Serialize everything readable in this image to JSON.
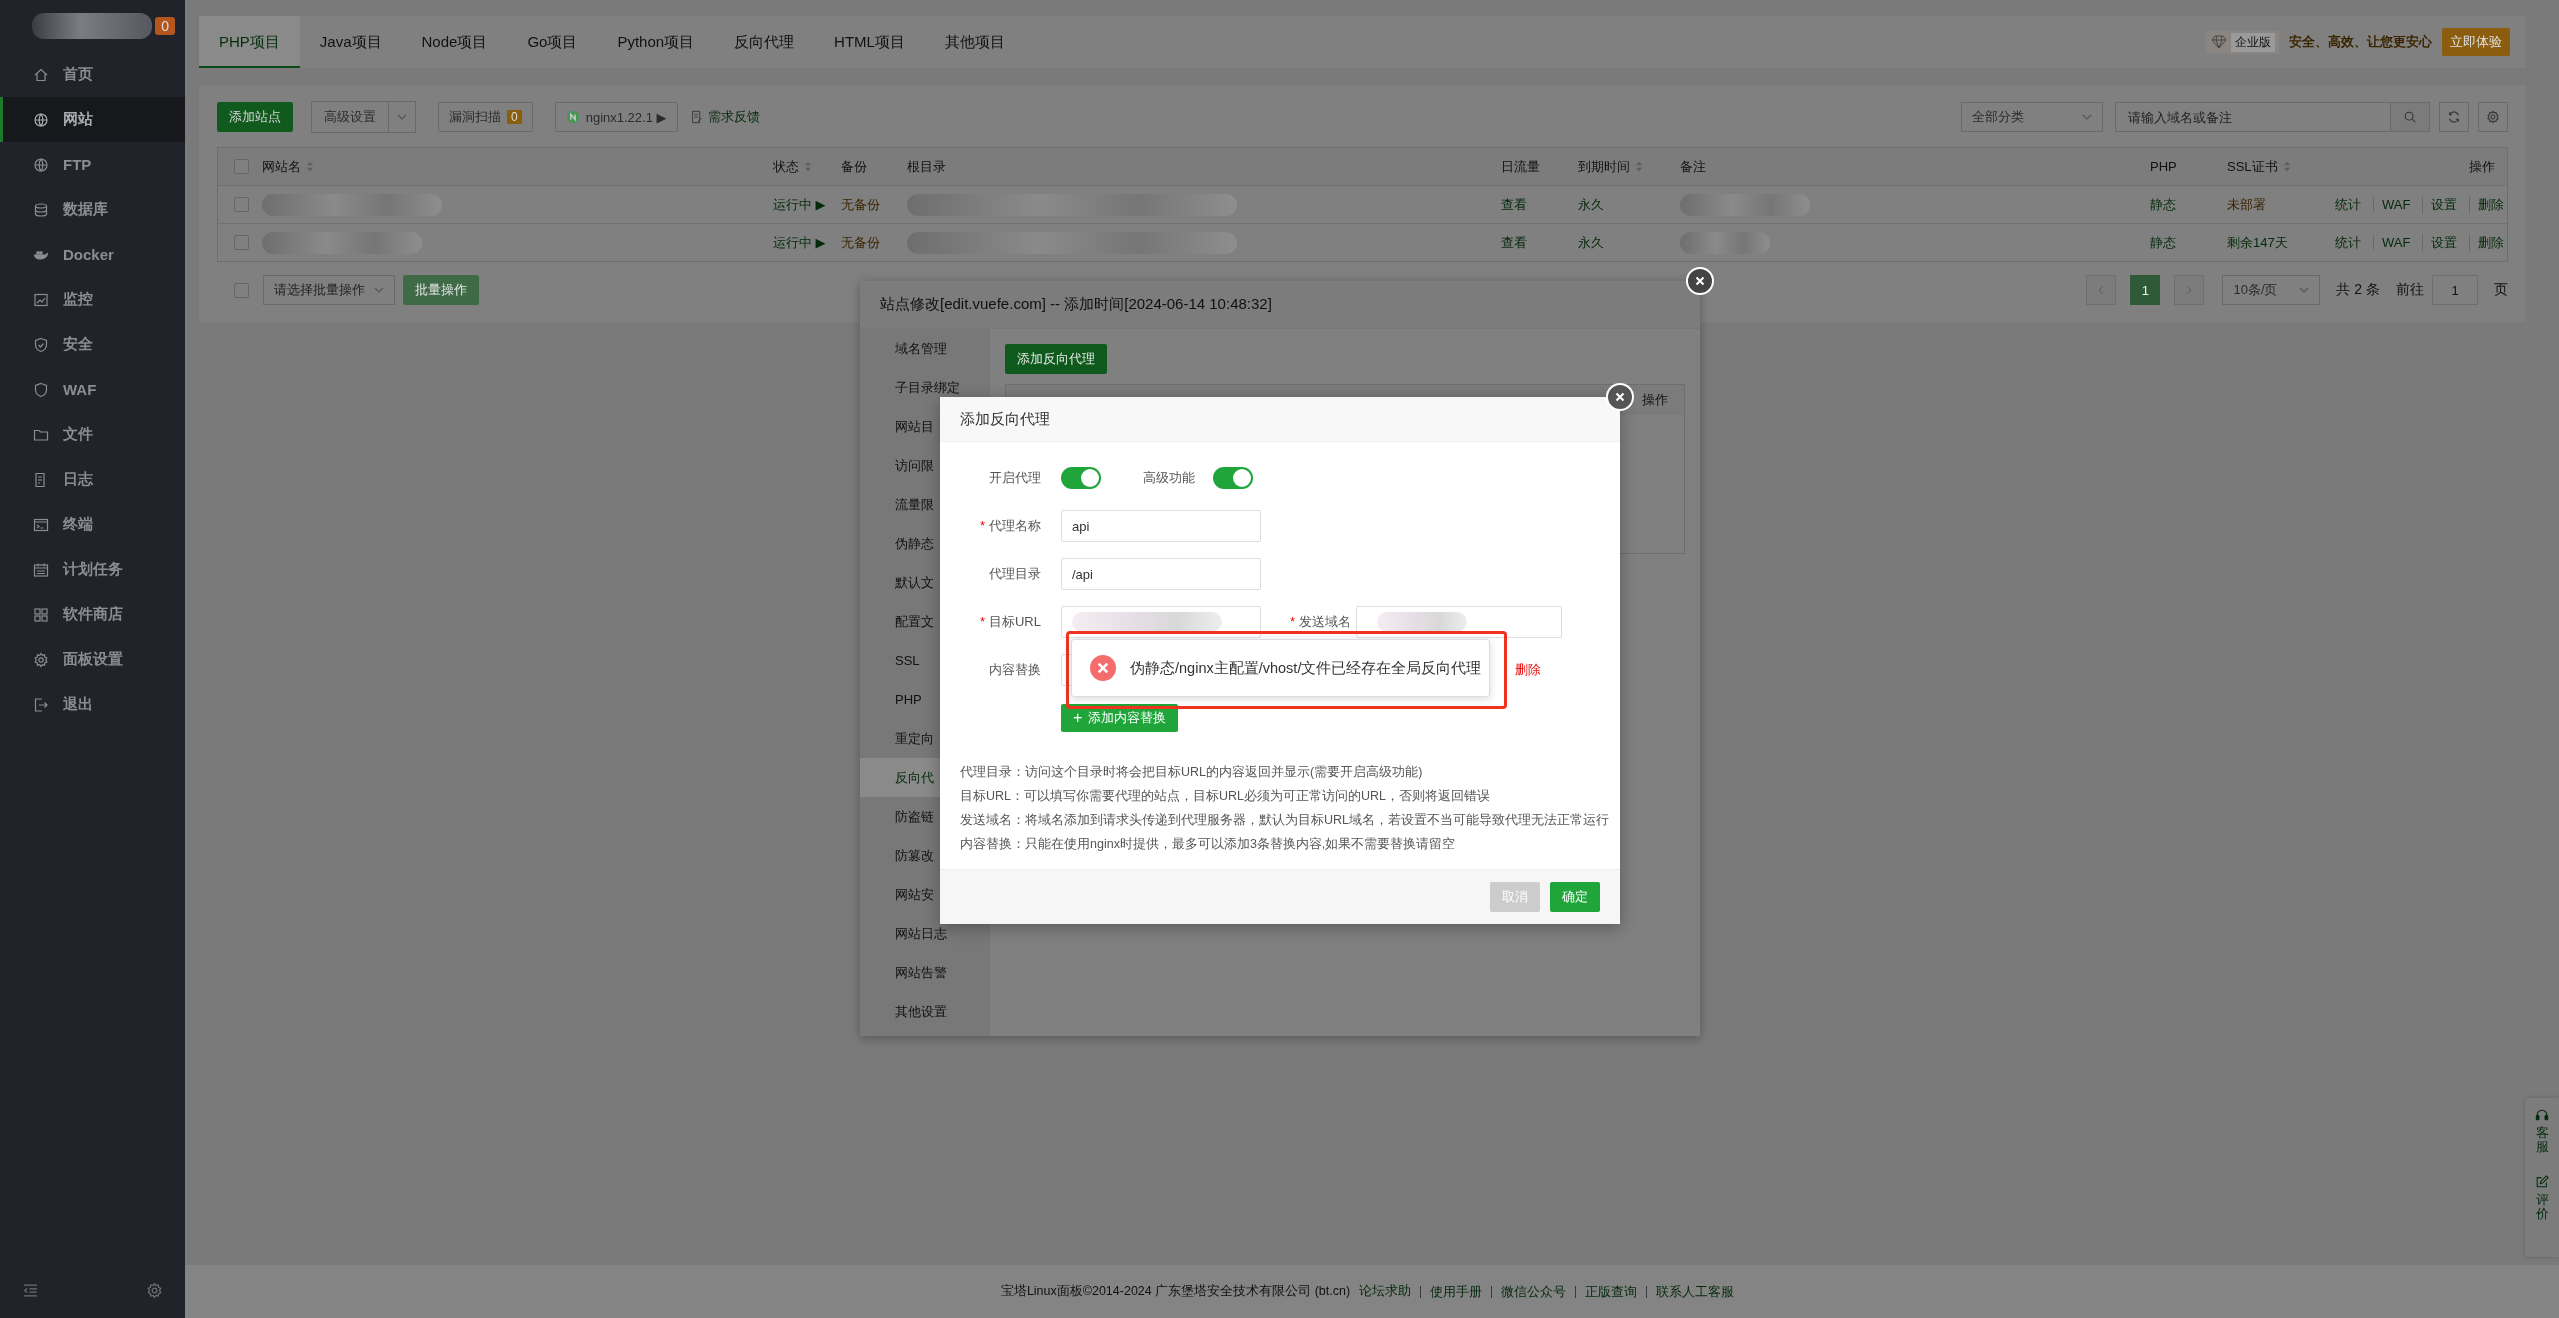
{
  "sidebar": {
    "badge": "0",
    "items": [
      {
        "label": "首页",
        "selected": false
      },
      {
        "label": "网站",
        "selected": true
      },
      {
        "label": "FTP",
        "selected": false
      },
      {
        "label": "数据库",
        "selected": false
      },
      {
        "label": "Docker",
        "selected": false
      },
      {
        "label": "监控",
        "selected": false
      },
      {
        "label": "安全",
        "selected": false
      },
      {
        "label": "WAF",
        "selected": false
      },
      {
        "label": "文件",
        "selected": false
      },
      {
        "label": "日志",
        "selected": false
      },
      {
        "label": "终端",
        "selected": false
      },
      {
        "label": "计划任务",
        "selected": false
      },
      {
        "label": "软件商店",
        "selected": false
      },
      {
        "label": "面板设置",
        "selected": false
      },
      {
        "label": "退出",
        "selected": false
      }
    ]
  },
  "tabs": [
    {
      "label": "PHP项目",
      "selected": true
    },
    {
      "label": "Java项目",
      "selected": false
    },
    {
      "label": "Node项目",
      "selected": false
    },
    {
      "label": "Go项目",
      "selected": false
    },
    {
      "label": "Python项目",
      "selected": false
    },
    {
      "label": "反向代理",
      "selected": false
    },
    {
      "label": "HTML项目",
      "selected": false
    },
    {
      "label": "其他项目",
      "selected": false
    }
  ],
  "promo": {
    "edition": "企业版",
    "slogan": "安全、高效、让您更安心",
    "button": "立即体验"
  },
  "toolbar": {
    "add_site": "添加站点",
    "advanced": "高级设置",
    "scan": "漏洞扫描",
    "scan_count": "0",
    "nginx": "nginx1.22.1 ▶",
    "feedback": "需求反馈",
    "category": "全部分类",
    "search_placeholder": "请输入域名或备注"
  },
  "table": {
    "all_checked": false,
    "columns": [
      {
        "label": "网站名",
        "sortable": true
      },
      {
        "label": "状态",
        "sortable": true
      },
      {
        "label": "备份",
        "sortable": false
      },
      {
        "label": "根目录",
        "sortable": false
      },
      {
        "label": "日流量",
        "sortable": false
      },
      {
        "label": "到期时间",
        "sortable": true
      },
      {
        "label": "备注",
        "sortable": false
      },
      {
        "label": "PHP",
        "sortable": false
      },
      {
        "label": "SSL证书",
        "sortable": true
      },
      {
        "label": "操作",
        "sortable": false
      }
    ],
    "rows": [
      {
        "checked": false,
        "status": "运行中 ▶",
        "backup": "无备份",
        "traffic": "查看",
        "expiry": "永久",
        "php": "静态",
        "ssl": "未部署",
        "ssl_ok": false,
        "actions": [
          "统计",
          "WAF",
          "设置",
          "删除"
        ]
      },
      {
        "checked": false,
        "status": "运行中 ▶",
        "backup": "无备份",
        "traffic": "查看",
        "expiry": "永久",
        "php": "静态",
        "ssl": "剩余147天",
        "ssl_ok": true,
        "actions": [
          "统计",
          "WAF",
          "设置",
          "删除"
        ]
      }
    ]
  },
  "batch": {
    "checked": false,
    "placeholder": "请选择批量操作",
    "button": "批量操作"
  },
  "pagination": {
    "pages": [
      {
        "label": "1",
        "selected": true
      }
    ],
    "page_size": "10条/页",
    "total": "共 2 条",
    "goto_label": "前往",
    "goto_value": "1",
    "page_suffix": "页"
  },
  "site_dialog": {
    "title": "站点修改[edit.vuefe.com] -- 添加时间[2024-06-14 10:48:32]",
    "nav": [
      {
        "label": "域名管理",
        "selected": false
      },
      {
        "label": "子目录绑定",
        "selected": false
      },
      {
        "label": "网站目",
        "selected": false
      },
      {
        "label": "访问限",
        "selected": false
      },
      {
        "label": "流量限",
        "selected": false
      },
      {
        "label": "伪静态",
        "selected": false
      },
      {
        "label": "默认文",
        "selected": false
      },
      {
        "label": "配置文",
        "selected": false
      },
      {
        "label": "SSL",
        "selected": false
      },
      {
        "label": "PHP",
        "selected": false
      },
      {
        "label": "重定向",
        "selected": false
      },
      {
        "label": "反向代",
        "selected": true
      },
      {
        "label": "防盗链",
        "selected": false
      },
      {
        "label": "防篡改",
        "selected": false
      },
      {
        "label": "网站安",
        "selected": false
      },
      {
        "label": "网站日志",
        "selected": false
      },
      {
        "label": "网站告警",
        "selected": false
      },
      {
        "label": "其他设置",
        "selected": false
      }
    ],
    "add_button": "添加反向代理",
    "table_action": "操作"
  },
  "proxy_dialog": {
    "title": "添加反向代理",
    "switches": [
      {
        "label": "开启代理",
        "on": true
      },
      {
        "label": "高级功能",
        "on": true
      }
    ],
    "fields": [
      {
        "kind": "text",
        "mark": "*",
        "label": "代理名称",
        "value": "api"
      },
      {
        "kind": "text",
        "label": "代理目录",
        "value": "/api"
      },
      {
        "kind": "redacted",
        "mark": "*",
        "label": "目标URL",
        "extra_mark": "*",
        "extra_label": "发送域名"
      },
      {
        "kind": "replace",
        "label": "内容替换",
        "action": "删除"
      }
    ],
    "add_replace": "添加内容替换",
    "add_icon": "+",
    "notes": [
      "代理目录：访问这个目录时将会把目标URL的内容返回并显示(需要开启高级功能)",
      "目标URL：可以填写你需要代理的站点，目标URL必须为可正常访问的URL，否则将返回错误",
      "发送域名：将域名添加到请求头传递到代理服务器，默认为目标URL域名，若设置不当可能导致代理无法正常运行",
      "内容替换：只能在使用nginx时提供，最多可以添加3条替换内容,如果不需要替换请留空"
    ],
    "cancel": "取消",
    "confirm": "确定"
  },
  "toast": {
    "message": "伪静态/nginx主配置/vhost/文件已经存在全局反向代理"
  },
  "footer": {
    "text": "宝塔Linux面板©2014-2024 广东堡塔安全技术有限公司 (bt.cn)",
    "links": [
      "论坛求助",
      "使用手册",
      "微信公众号",
      "正版查询",
      "联系人工客服"
    ]
  },
  "float_bar": [
    {
      "label": "客服"
    },
    {
      "label": "评价"
    }
  ]
}
